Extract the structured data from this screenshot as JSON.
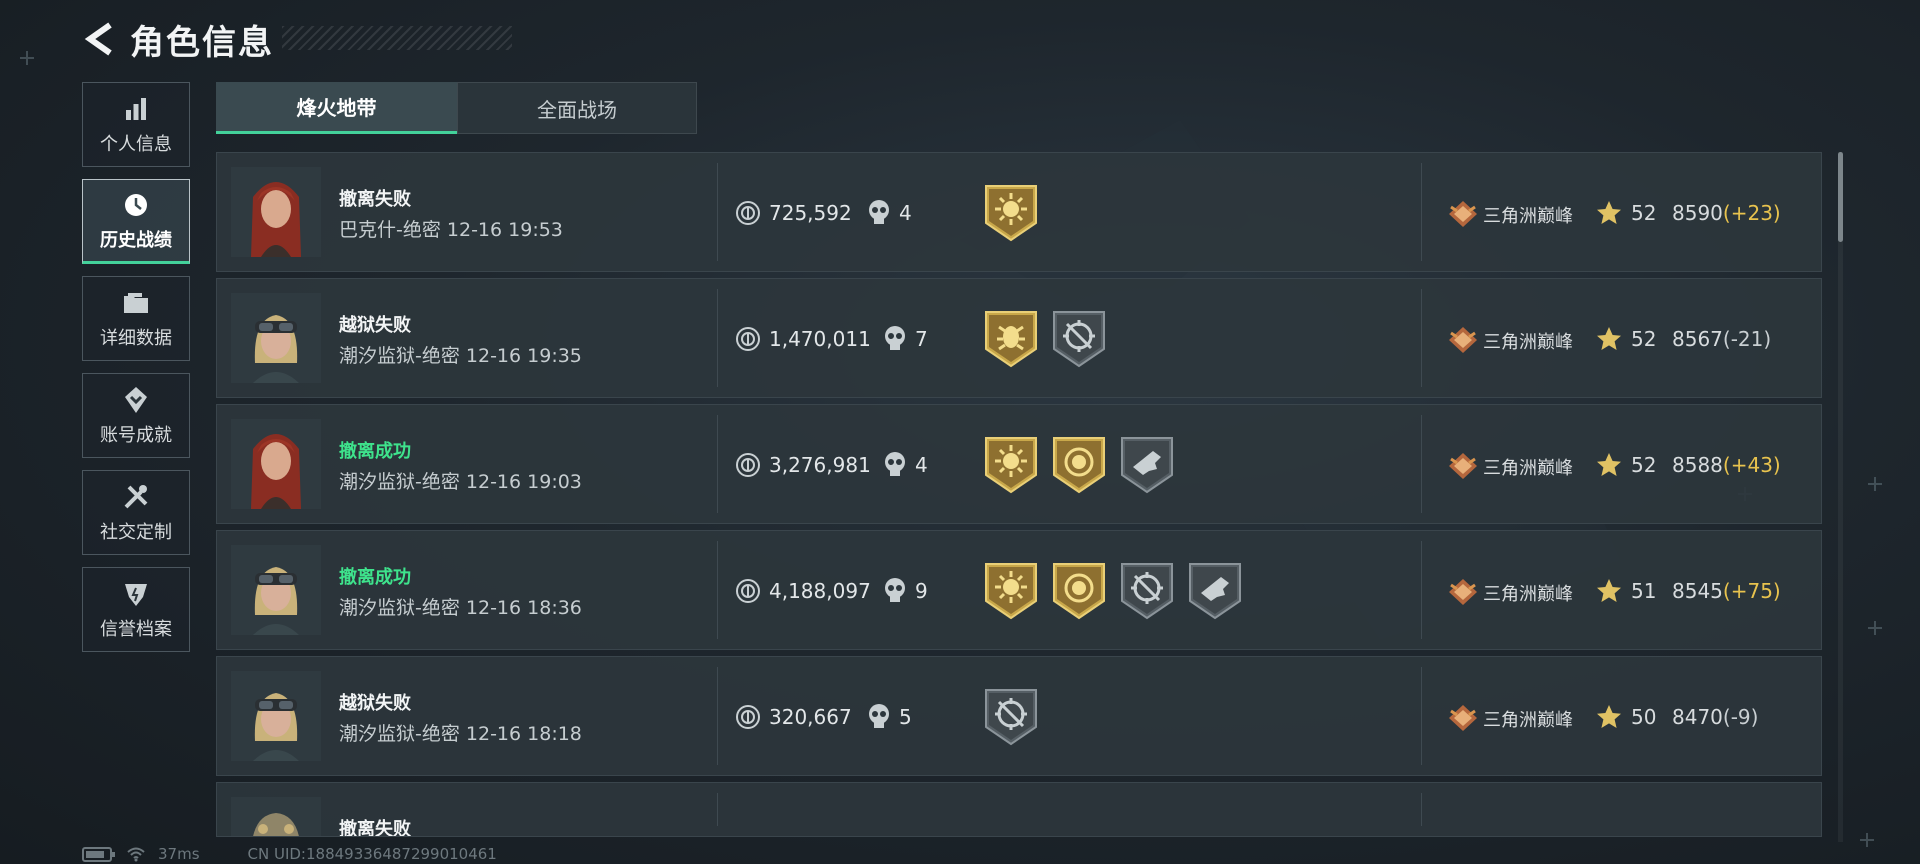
{
  "header": {
    "title": "角色信息"
  },
  "sidebar": {
    "items": [
      {
        "label": "个人信息",
        "icon": "bar-chart-icon",
        "active": false
      },
      {
        "label": "历史战绩",
        "icon": "history-clock-icon",
        "active": true
      },
      {
        "label": "详细数据",
        "icon": "folder-icon",
        "active": false
      },
      {
        "label": "账号成就",
        "icon": "achievement-icon",
        "active": false
      },
      {
        "label": "社交定制",
        "icon": "tools-icon",
        "active": false
      },
      {
        "label": "信誉档案",
        "icon": "shield-icon",
        "active": false
      }
    ]
  },
  "tabs": [
    {
      "label": "烽火地带",
      "active": true
    },
    {
      "label": "全面战场",
      "active": false
    }
  ],
  "colors": {
    "accent_green": "#43d19a",
    "success_text": "#3ee38c",
    "gold": "#d8b54a",
    "delta_up": "#e8c34e"
  },
  "matches": [
    {
      "avatar": "red-hair-operator",
      "result": "撤离失败",
      "success": false,
      "meta": "巴克什-绝密 12-16 19:53",
      "value": "725,592",
      "kills": "4",
      "badges": [
        "gold-sun-badge"
      ],
      "rank": "三角洲巅峰",
      "level": "52",
      "score": "8590",
      "delta": "(+23)",
      "delta_dir": "up"
    },
    {
      "avatar": "goggles-operator",
      "result": "越狱失败",
      "success": false,
      "meta": "潮汐监狱-绝密 12-16 19:35",
      "value": "1,470,011",
      "kills": "7",
      "badges": [
        "gold-bug-badge",
        "gray-crosshair-badge"
      ],
      "rank": "三角洲巅峰",
      "level": "52",
      "score": "8567",
      "delta": "(-21)",
      "delta_dir": "down"
    },
    {
      "avatar": "red-hair-operator",
      "result": "撤离成功",
      "success": true,
      "meta": "潮汐监狱-绝密 12-16 19:03",
      "value": "3,276,981",
      "kills": "4",
      "badges": [
        "gold-sun-badge",
        "gold-coin-badge",
        "gray-gun-badge"
      ],
      "rank": "三角洲巅峰",
      "level": "52",
      "score": "8588",
      "delta": "(+43)",
      "delta_dir": "up"
    },
    {
      "avatar": "goggles-operator",
      "result": "撤离成功",
      "success": true,
      "meta": "潮汐监狱-绝密 12-16 18:36",
      "value": "4,188,097",
      "kills": "9",
      "badges": [
        "gold-sun-badge",
        "gold-coin-badge",
        "gray-crosshair-badge",
        "gray-gun-badge"
      ],
      "rank": "三角洲巅峰",
      "level": "51",
      "score": "8545",
      "delta": "(+75)",
      "delta_dir": "up"
    },
    {
      "avatar": "goggles-operator",
      "result": "越狱失败",
      "success": false,
      "meta": "潮汐监狱-绝密 12-16 18:18",
      "value": "320,667",
      "kills": "5",
      "badges": [
        "gray-crosshair-badge"
      ],
      "rank": "三角洲巅峰",
      "level": "50",
      "score": "8470",
      "delta": "(-9)",
      "delta_dir": "down"
    },
    {
      "avatar": "armored-operator",
      "result": "撤离失败",
      "success": false,
      "partial": true
    }
  ],
  "footer": {
    "ping": "37ms",
    "uid": "CN UID:18849336487299010461"
  }
}
